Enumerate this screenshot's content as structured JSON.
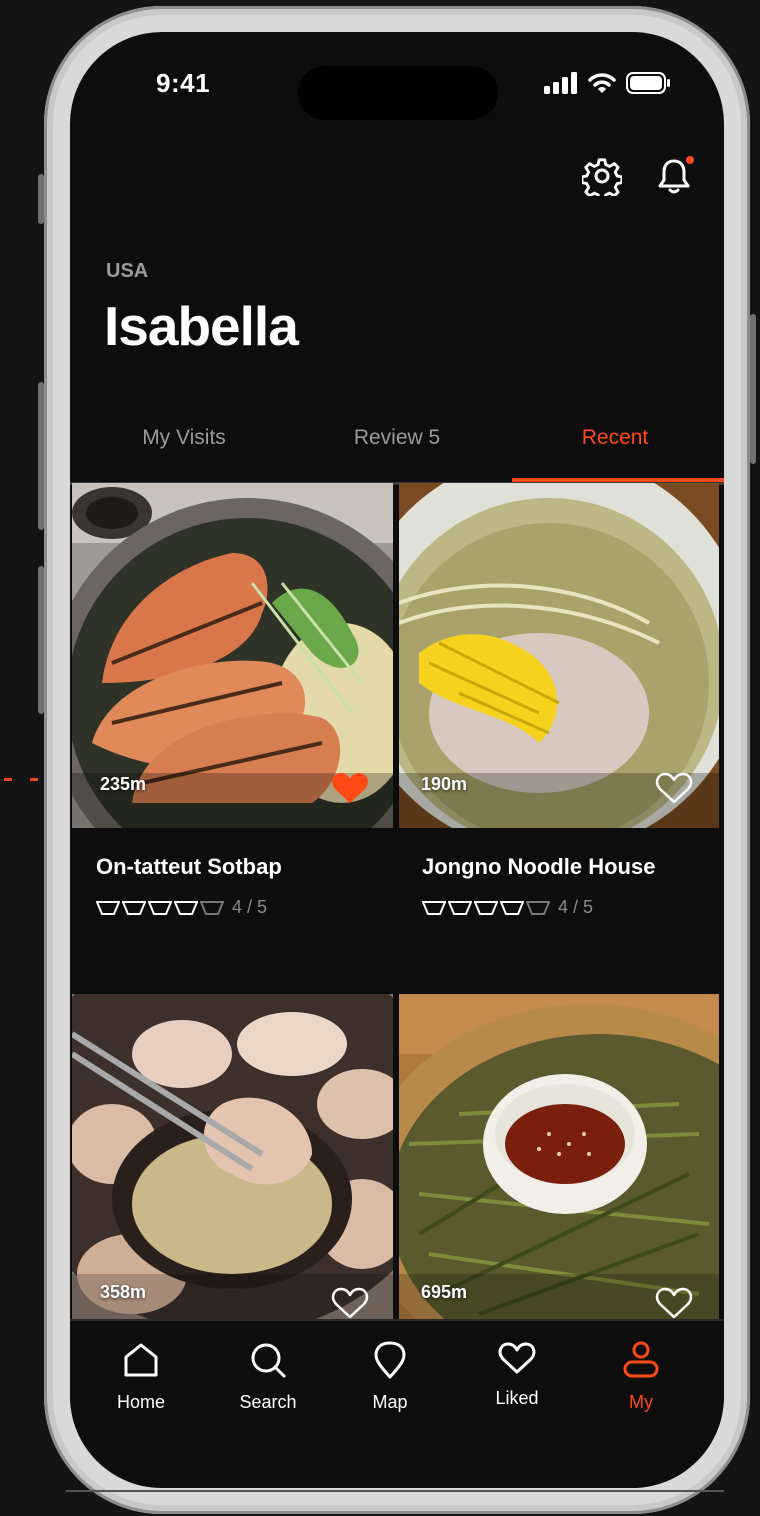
{
  "status_bar": {
    "time": "9:41"
  },
  "profile": {
    "country": "USA",
    "name": "Isabella"
  },
  "tabs": [
    {
      "label": "My Visits",
      "active": false
    },
    {
      "label": "Review 5",
      "active": false
    },
    {
      "label": "Recent",
      "active": true
    }
  ],
  "places": [
    {
      "distance": "235m",
      "name": "On-tatteut Sotbap",
      "rating_text": "4 / 5",
      "rating": 4,
      "liked": true
    },
    {
      "distance": "190m",
      "name": "Jongno Noodle House",
      "rating_text": "4 / 5",
      "rating": 4,
      "liked": false
    },
    {
      "distance": "358m",
      "liked": false
    },
    {
      "distance": "695m",
      "liked": false
    }
  ],
  "nav": [
    {
      "label": "Home",
      "icon": "home-icon",
      "active": false
    },
    {
      "label": "Search",
      "icon": "search-icon",
      "active": false
    },
    {
      "label": "Map",
      "icon": "map-pin-icon",
      "active": false
    },
    {
      "label": "Liked",
      "icon": "heart-icon",
      "active": false
    },
    {
      "label": "My",
      "icon": "user-icon",
      "active": true
    }
  ],
  "colors": {
    "accent": "#ff4a16",
    "background": "#0d0d0d",
    "muted": "#9a9a9a"
  }
}
